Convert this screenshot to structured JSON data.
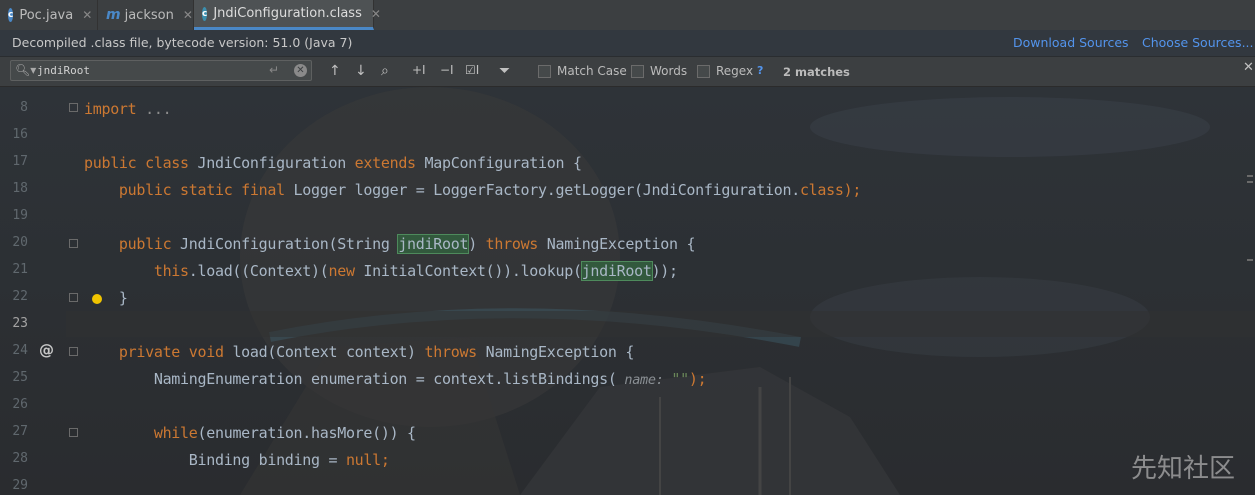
{
  "tabs": [
    {
      "label": "Poc.java",
      "icon": "java-class-icon",
      "active": false
    },
    {
      "label": "jackson",
      "icon": "maven-module-icon",
      "active": false
    },
    {
      "label": "JndiConfiguration.class",
      "icon": "class-file-icon",
      "active": true
    }
  ],
  "banner": {
    "message": "Decompiled .class file, bytecode version: 51.0 (Java 7)",
    "download_sources": "Download Sources",
    "choose_sources": "Choose Sources..."
  },
  "find": {
    "query": "jndiRoot",
    "match_case": "Match Case",
    "words": "Words",
    "regex": "Regex",
    "help": "?",
    "matches": "2 matches"
  },
  "editor": {
    "line_numbers": [
      "8",
      "16",
      "17",
      "18",
      "19",
      "20",
      "21",
      "22",
      "23",
      "24",
      "25",
      "26",
      "27",
      "28",
      "29"
    ],
    "lines": {
      "l8_kw": "import",
      "l8_fold": " ...",
      "l17_a": "public class ",
      "l17_b": "JndiConfiguration ",
      "l17_c": "extends ",
      "l17_d": "MapConfiguration {",
      "l18_a": "    public static final ",
      "l18_b": "Logger logger = LoggerFactory.getLogger(JndiConfiguration.",
      "l18_c": "class",
      "l18_d": ");",
      "l20_a": "    public ",
      "l20_b": "JndiConfiguration(String ",
      "l20_match": "jndiRoot",
      "l20_c": ") ",
      "l20_d": "throws ",
      "l20_e": "NamingException {",
      "l21_a": "        this",
      "l21_b": ".load((Context)(",
      "l21_c": "new ",
      "l21_d": "InitialContext()).lookup(",
      "l21_match": "jndiRoot",
      "l21_e": "));",
      "l22": "    }",
      "l24_a": "    private void ",
      "l24_b": "load(Context context) ",
      "l24_c": "throws ",
      "l24_d": "NamingException {",
      "l25_a": "        NamingEnumeration enumeration = context.listBindings(",
      "l25_hint": " name: ",
      "l25_str": "\"\"",
      "l25_b": ");",
      "l27_a": "        while",
      "l27_b": "(enumeration.hasMore()) {",
      "l28_a": "            Binding binding = ",
      "l28_b": "null",
      "l28_c": ";"
    },
    "override_marker": "@",
    "watermark": "先知社区"
  }
}
